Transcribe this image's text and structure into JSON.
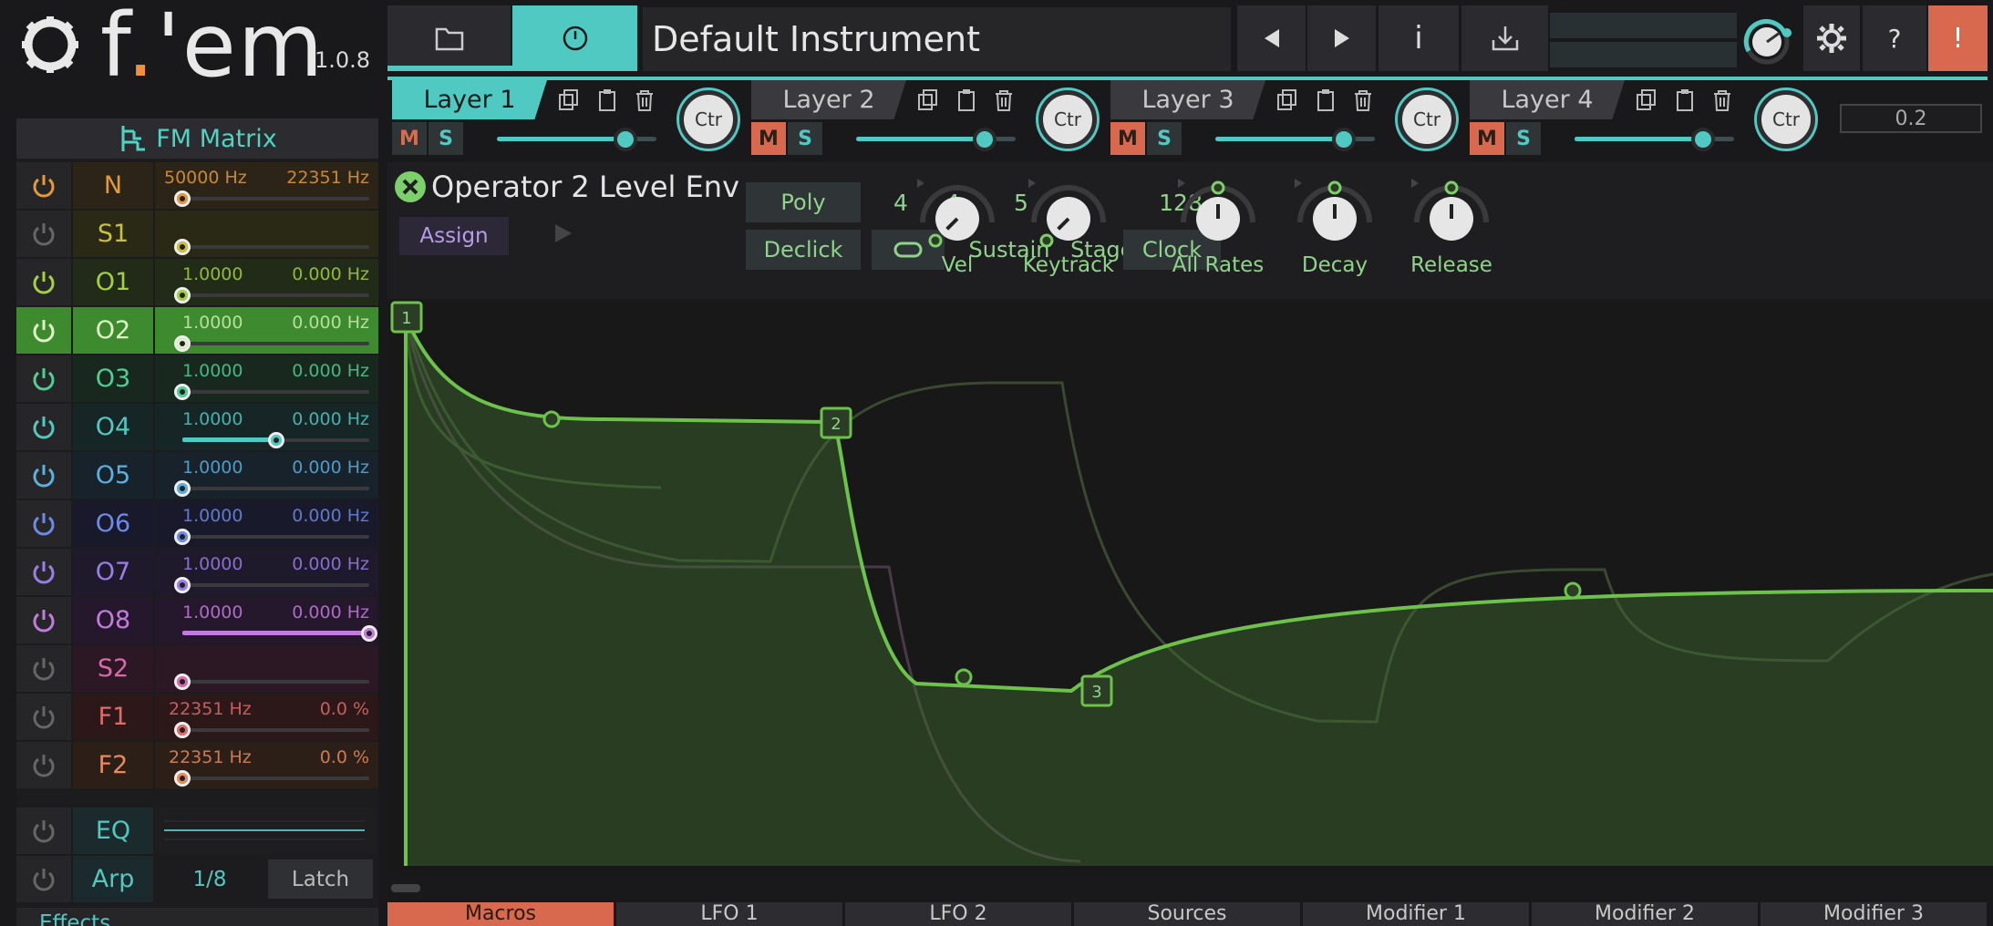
{
  "app": {
    "logo_text_f": "f",
    "logo_text_dot": ".",
    "logo_text_em": "'em",
    "version": "1.0.8"
  },
  "matrix": {
    "title": "FM Matrix",
    "rows": [
      {
        "name": "N",
        "v1": "50000 Hz",
        "v2": "22351 Hz",
        "color": "#e59a3a",
        "bg": "#2c2416",
        "fill": 0,
        "power": true
      },
      {
        "name": "S1",
        "v1": "",
        "v2": "",
        "color": "#c9c13b",
        "bg": "#2a2916",
        "fill": 0,
        "power": false
      },
      {
        "name": "O1",
        "v1": "1.0000",
        "v2": "0.000 Hz",
        "color": "#a4d23f",
        "bg": "#222b18",
        "fill": 0,
        "power": true
      },
      {
        "name": "O2",
        "v1": "1.0000",
        "v2": "0.000 Hz",
        "color": "#dff5c8",
        "bg": "#3e8a2e",
        "fill": 0,
        "power": true
      },
      {
        "name": "O3",
        "v1": "1.0000",
        "v2": "0.000 Hz",
        "color": "#4fcf94",
        "bg": "#18281f",
        "fill": 0,
        "power": true
      },
      {
        "name": "O4",
        "v1": "1.0000",
        "v2": "0.000 Hz",
        "color": "#4fc9c2",
        "bg": "#162626",
        "fill": 0.5,
        "power": true
      },
      {
        "name": "O5",
        "v1": "1.0000",
        "v2": "0.000 Hz",
        "color": "#5ab0e0",
        "bg": "#17222b",
        "fill": 0,
        "power": true
      },
      {
        "name": "O6",
        "v1": "1.0000",
        "v2": "0.000 Hz",
        "color": "#6c8be8",
        "bg": "#19192c",
        "fill": 0,
        "power": true
      },
      {
        "name": "O7",
        "v1": "1.0000",
        "v2": "0.000 Hz",
        "color": "#9a7ee6",
        "bg": "#1f192c",
        "fill": 0,
        "power": true
      },
      {
        "name": "O8",
        "v1": "1.0000",
        "v2": "0.000 Hz",
        "color": "#c37be0",
        "bg": "#26182c",
        "fill": 1,
        "power": true
      },
      {
        "name": "S2",
        "v1": "",
        "v2": "",
        "color": "#d86aa8",
        "bg": "#2c1824",
        "fill": 0,
        "power": false
      },
      {
        "name": "F1",
        "v1": "22351 Hz",
        "v2": "0.0 %",
        "color": "#e26a6a",
        "bg": "#2c1818",
        "fill": 0,
        "power": false
      },
      {
        "name": "F2",
        "v1": "22351 Hz",
        "v2": "0.0 %",
        "color": "#e88a5a",
        "bg": "#2c1f18",
        "fill": 0,
        "power": false
      }
    ],
    "eq_label": "EQ",
    "arp_label": "Arp",
    "arp_rate": "1/8",
    "arp_latch": "Latch",
    "effects_label": "Effects"
  },
  "toolbar": {
    "preset_name": "Default Instrument",
    "info_label": "i",
    "help_label": "?",
    "alert_label": "!"
  },
  "layers": [
    {
      "label": "Layer 1",
      "active": true,
      "mute": false,
      "ctr": "Ctr"
    },
    {
      "label": "Layer 2",
      "active": false,
      "mute": true,
      "ctr": "Ctr"
    },
    {
      "label": "Layer 3",
      "active": false,
      "mute": true,
      "ctr": "Ctr"
    },
    {
      "label": "Layer 4",
      "active": false,
      "mute": true,
      "ctr": "Ctr"
    }
  ],
  "mute_label": "M",
  "solo_label": "S",
  "layer_value": "0.2",
  "envelope": {
    "title": "Operator 2 Level Env",
    "assign": "Assign",
    "poly": "Poly",
    "declick": "Declick",
    "val_a": "4",
    "val_b": "4",
    "val_c": "5",
    "val_d": "128",
    "sustain_label": "Sustain",
    "stages_label": "Stages",
    "clock": "Clock",
    "knobs": [
      "Vel",
      "Keytrack",
      "All Rates",
      "Decay",
      "Release"
    ],
    "points": [
      "1",
      "2",
      "3"
    ]
  },
  "bottom_tabs": [
    "Macros",
    "LFO 1",
    "LFO 2",
    "Sources",
    "Modifier 1",
    "Modifier 2",
    "Modifier 3"
  ],
  "colors": {
    "accent": "#4fc9c2",
    "env_green": "#6cc24a",
    "mute_on": "#d8694e"
  }
}
